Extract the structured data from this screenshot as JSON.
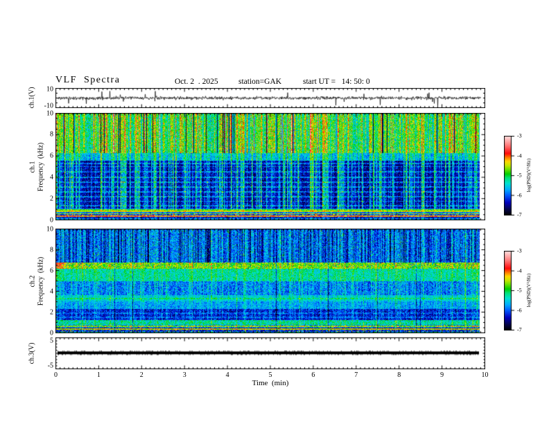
{
  "figure": {
    "title": "VLF  Spectra",
    "date": "Oct. 2  . 2025",
    "station": "station=GAK",
    "start_ut": "start UT =   14: 50: 0"
  },
  "time_axis": {
    "label": "Time  (min)",
    "range": [
      0,
      10
    ],
    "major_ticks": [
      "0",
      "1",
      "2",
      "3",
      "4",
      "5",
      "6",
      "7",
      "8",
      "9",
      "10"
    ],
    "minor_per_major": 10,
    "data_end_min": 9.85
  },
  "colormap": {
    "vmin": -7,
    "vmax": -3,
    "stops": [
      [
        0.0,
        0,
        0,
        0
      ],
      [
        0.07,
        5,
        5,
        70
      ],
      [
        0.16,
        0,
        0,
        190
      ],
      [
        0.25,
        0,
        90,
        255
      ],
      [
        0.32,
        0,
        170,
        255
      ],
      [
        0.4,
        0,
        225,
        210
      ],
      [
        0.47,
        0,
        225,
        120
      ],
      [
        0.52,
        0,
        205,
        0
      ],
      [
        0.58,
        110,
        225,
        0
      ],
      [
        0.63,
        200,
        230,
        0
      ],
      [
        0.68,
        255,
        215,
        0
      ],
      [
        0.73,
        255,
        120,
        0
      ],
      [
        0.78,
        255,
        10,
        10
      ],
      [
        0.88,
        255,
        120,
        120
      ],
      [
        1.0,
        255,
        225,
        225
      ]
    ]
  },
  "colorbars": [
    {
      "ticks": [
        "-3",
        "-4",
        "-5",
        "-6",
        "-7"
      ],
      "label": "log(PSD)(V²/Hz)"
    },
    {
      "ticks": [
        "-3",
        "-4",
        "-5",
        "-6",
        "-7"
      ],
      "label": "log(PSD)(V²/Hz)"
    }
  ],
  "chart_data": [
    {
      "id": "ch1-waveform",
      "type": "line",
      "ylabel": "ch.1(V)",
      "ylim": [
        -10,
        10
      ],
      "ytick_labels": [
        "10",
        "-10"
      ],
      "signal": {
        "mean": 0,
        "noise_std": 1.1,
        "spike_prob": 0.013,
        "spike_amp": [
          3,
          9
        ]
      },
      "seed": 11
    },
    {
      "id": "ch1-spectrogram",
      "type": "heatmap",
      "channel": "ch.1",
      "ylabel": "Frequency  (kHz)",
      "ylim": [
        0,
        10
      ],
      "ytick_labels": [
        "0",
        "2",
        "4",
        "6",
        "8",
        "10"
      ],
      "psd_range": [
        -7,
        -3
      ],
      "column_effects": {
        "streak_max": 1.6,
        "hot_prob": 0.1,
        "dark_prob": 0.04,
        "darkstreak_max": 0,
        "bright_line_prob": 0,
        "bright_boost": 0,
        "dark_line_prob": 0,
        "dark_drop": 0
      },
      "bands": [
        {
          "f": [
            6.25,
            10
          ],
          "level": -5.15,
          "jitter": 0.5,
          "col_gain": 0.9,
          "streak_gain": 0.55,
          "hot_boost": 0.75,
          "dark_cols": true
        },
        {
          "f": [
            5.55,
            6.25
          ],
          "level": -5.75,
          "jitter": 0.45,
          "streak_gain": 0.8
        },
        {
          "f": [
            1.08,
            5.55
          ],
          "level": -6.62,
          "jitter": 0.38,
          "streak_gain": 1.05,
          "speckle_prob": 0.05,
          "speckle_boost": 0.7,
          "h_lines": [
            1.35,
            1.75,
            2.2,
            2.65,
            3.1,
            3.55,
            4.0,
            4.5,
            5.0,
            5.3
          ],
          "h_line_boost": 0.5
        },
        {
          "f": [
            1.0,
            1.08
          ],
          "level": -5.9,
          "jitter": 0.3,
          "streak_gain": 0.3
        },
        {
          "f": [
            0.86,
            1.0
          ],
          "level": -4.9,
          "jitter": 0.35,
          "streak_gain": 0.3
        },
        {
          "f": [
            0.72,
            0.86
          ],
          "level": -4.55,
          "jitter": 0.3,
          "streak_gain": 0.3
        },
        {
          "f": [
            0.62,
            0.72
          ],
          "level": -6.0,
          "jitter": 0.4,
          "streak_gain": 0.3
        },
        {
          "f": [
            0.52,
            0.62
          ],
          "level": -4.7,
          "jitter": 0.4,
          "streak_gain": 0.3
        },
        {
          "f": [
            0.4,
            0.52
          ],
          "level": -6.2,
          "jitter": 0.4,
          "streak_gain": 0.3,
          "speckle_prob": 0.15,
          "speckle_boost": 1.8
        },
        {
          "f": [
            0.28,
            0.4
          ],
          "level": -4.25,
          "jitter": 0.45,
          "streak_gain": 0.3
        },
        {
          "f": [
            0.16,
            0.28
          ],
          "level": -6.4,
          "jitter": 0.35,
          "streak_gain": 0.3
        },
        {
          "f": [
            0.0,
            0.16
          ],
          "level": -5.9,
          "jitter": 0.5,
          "streak_gain": 0.3
        }
      ],
      "seed": 23
    },
    {
      "id": "ch2-spectrogram",
      "type": "heatmap",
      "channel": "ch.2",
      "ylabel": "Frequency  (kHz)",
      "ylim": [
        0,
        10
      ],
      "ytick_labels": [
        "0",
        "2",
        "4",
        "6",
        "8",
        "10"
      ],
      "psd_range": [
        -7,
        -3
      ],
      "column_effects": {
        "streak_max": 1.1,
        "hot_prob": 0,
        "dark_prob": 0,
        "darkstreak_max": 1.2,
        "bright_line_prob": 0.05,
        "bright_boost": 0.45,
        "dark_line_prob": 0.03,
        "dark_drop": 0.8
      },
      "bands": [
        {
          "f": [
            6.78,
            10
          ],
          "level": -5.82,
          "jitter": 0.42,
          "streak_gain": 0.3,
          "darkstreak_gain": 0.9,
          "speckle_prob": 0.07,
          "speckle_boost": 0.75
        },
        {
          "f": [
            6.15,
            6.78
          ],
          "level": -4.78,
          "jitter": 0.45,
          "streak_gain": 0.3,
          "speckle_prob": 0.05,
          "speckle_boost": 0.55,
          "darkspeck_prob": 0.06,
          "darkspeck_drop": 1.3,
          "left_blob": {
            "cols": 22,
            "boost": 0.55
          }
        },
        {
          "f": [
            5.0,
            6.15
          ],
          "level": -5.38,
          "jitter": 0.4,
          "streak_gain": 0.4
        },
        {
          "f": [
            3.62,
            5.0
          ],
          "level": -6.02,
          "jitter": 0.42,
          "streak_gain": 0.6,
          "speckle_prob": 0.06,
          "speckle_boost": 0.6
        },
        {
          "f": [
            3.02,
            3.62
          ],
          "level": -5.55,
          "jitter": 0.38,
          "streak_gain": 0.3,
          "h_lines": [
            3.3
          ],
          "h_line_boost": 0.35
        },
        {
          "f": [
            2.28,
            3.02
          ],
          "level": -5.82,
          "jitter": 0.4,
          "streak_gain": 0.35
        },
        {
          "f": [
            1.22,
            2.28
          ],
          "level": -6.38,
          "jitter": 0.42,
          "streak_gain": 0.5,
          "h_lines": [
            1.5,
            1.9
          ],
          "h_line_boost": 0.3
        },
        {
          "f": [
            0.78,
            1.22
          ],
          "level": -5.35,
          "jitter": 0.5,
          "streak_gain": 0.2
        },
        {
          "f": [
            0.5,
            0.78
          ],
          "level": -5.9,
          "jitter": 0.5,
          "streak_gain": 0.2,
          "h_lines": [
            0.62
          ],
          "h_line_boost": 1.2,
          "speckle_prob": 0.08,
          "speckle_boost": 1.0
        },
        {
          "f": [
            0.28,
            0.5
          ],
          "level": -6.4,
          "jitter": 0.4,
          "streak_gain": 0.2,
          "h_lines": [
            0.38
          ],
          "h_line_boost": 1.9
        },
        {
          "f": [
            0.12,
            0.28
          ],
          "level": -6.3,
          "jitter": 0.4,
          "streak_gain": 0.2,
          "speckle_prob": 0.12,
          "speckle_boost": 1.8
        },
        {
          "f": [
            0.0,
            0.12
          ],
          "level": -5.5,
          "jitter": 0.6,
          "streak_gain": 0.2
        }
      ],
      "seed": 37
    },
    {
      "id": "ch3-waveform",
      "type": "line",
      "ylabel": "ch.3(V)",
      "ylim": [
        -5,
        5
      ],
      "ytick_labels": [
        "5",
        "-5"
      ],
      "signal": {
        "flat_value": 0.15,
        "bar_thickness_px": 4
      },
      "seed": 51
    }
  ]
}
